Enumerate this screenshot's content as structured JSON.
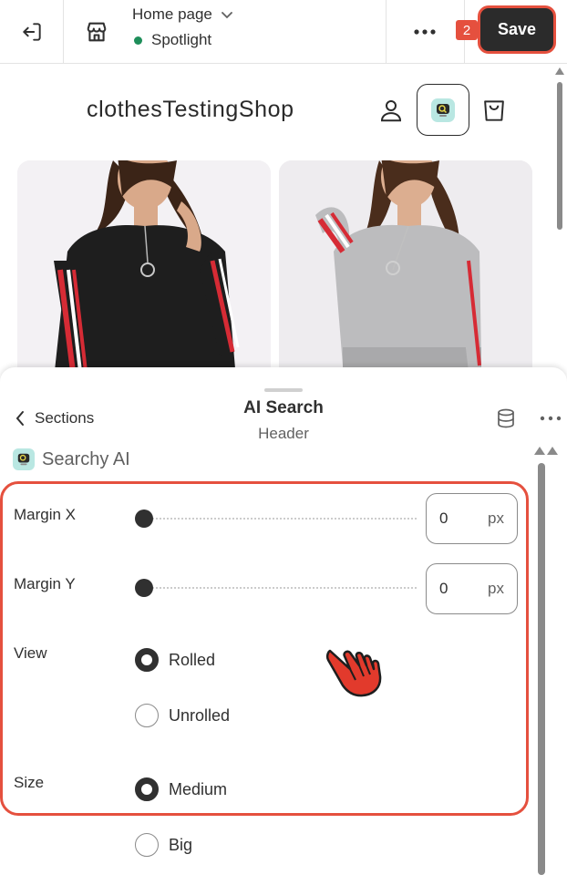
{
  "topbar": {
    "page_title": "Home page",
    "theme_name": "Spotlight",
    "unsaved_count": "2",
    "save_label": "Save"
  },
  "preview": {
    "shop_name": "clothesTestingShop"
  },
  "sheet": {
    "back_label": "Sections",
    "title": "AI Search",
    "subtitle": "Header",
    "app_name": "Searchy AI"
  },
  "settings": {
    "margin_x": {
      "label": "Margin X",
      "value": "0",
      "unit": "px",
      "level": 0
    },
    "margin_y": {
      "label": "Margin Y",
      "value": "0",
      "unit": "px",
      "level": 0
    },
    "view": {
      "label": "View",
      "options": [
        {
          "label": "Rolled",
          "selected": true
        },
        {
          "label": "Unrolled",
          "selected": false
        }
      ]
    },
    "size": {
      "label": "Size",
      "options": [
        {
          "label": "Medium",
          "selected": true
        },
        {
          "label": "Big",
          "selected": false
        }
      ]
    }
  },
  "colors": {
    "accent": "#e5503e",
    "save_bg": "#2b2b2b",
    "status_green": "#1e8e5a",
    "app_logo_bg": "#b9e7e2"
  },
  "icons": [
    "exit-icon",
    "store-icon",
    "chevron-down-icon",
    "more-horizontal-icon",
    "user-icon",
    "searchy-logo-icon",
    "shopping-bag-icon",
    "chevron-left-icon",
    "database-icon",
    "pointer-hand-icon"
  ]
}
